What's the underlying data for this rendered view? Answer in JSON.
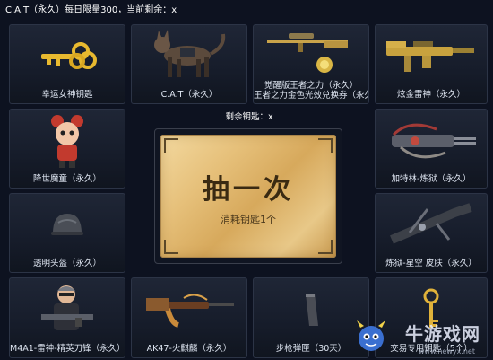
{
  "header": {
    "title": "C.A.T（永久）每日限量300，当前剩余：x"
  },
  "center": {
    "remaining_keys": "剩余钥匙：x",
    "draw_button_title": "抽一次",
    "draw_button_sub": "消耗钥匙1个"
  },
  "prizes": {
    "p1": {
      "label": "幸运女神钥匙",
      "icon": "gold-key-icon"
    },
    "p2": {
      "label": "C.A.T（永久）",
      "icon": "cat-character-icon"
    },
    "p3": {
      "label_line1": "觉醒版王者之力（永久）",
      "label_line2": "王者之力金色光效兑换券（永久）",
      "icon": "sniper-rifle-icon"
    },
    "p4": {
      "label": "炫金雷神（永久）",
      "icon": "gold-rifle-icon"
    },
    "p5": {
      "label": "降世魔童（永久）",
      "icon": "nezha-character-icon"
    },
    "p6": {
      "label": "加特林-炼狱（永久）",
      "icon": "gatling-icon"
    },
    "p7": {
      "label": "透明头盔（永久）",
      "icon": "helmet-icon"
    },
    "p8": {
      "label": "炼狱-星空 皮肤（永久）",
      "icon": "dark-rifle-icon"
    },
    "p9": {
      "label": "M4A1-雷神-精英刀锋（永久）",
      "icon": "soldier-character-icon"
    },
    "p10": {
      "label": "AK47-火麒麟（永久）",
      "icon": "ak47-icon"
    },
    "p11": {
      "label": "步枪弹匣（30天）",
      "icon": "magazine-icon"
    },
    "p12": {
      "label": "交易专用钥匙（5个）",
      "icon": "trade-key-icon"
    }
  },
  "watermark": {
    "text": "牛游戏网",
    "url": "www.newyx.net"
  },
  "colors": {
    "background": "#0d1220",
    "gold_button": "#e6c07a",
    "cell_border": "#2c3446"
  }
}
